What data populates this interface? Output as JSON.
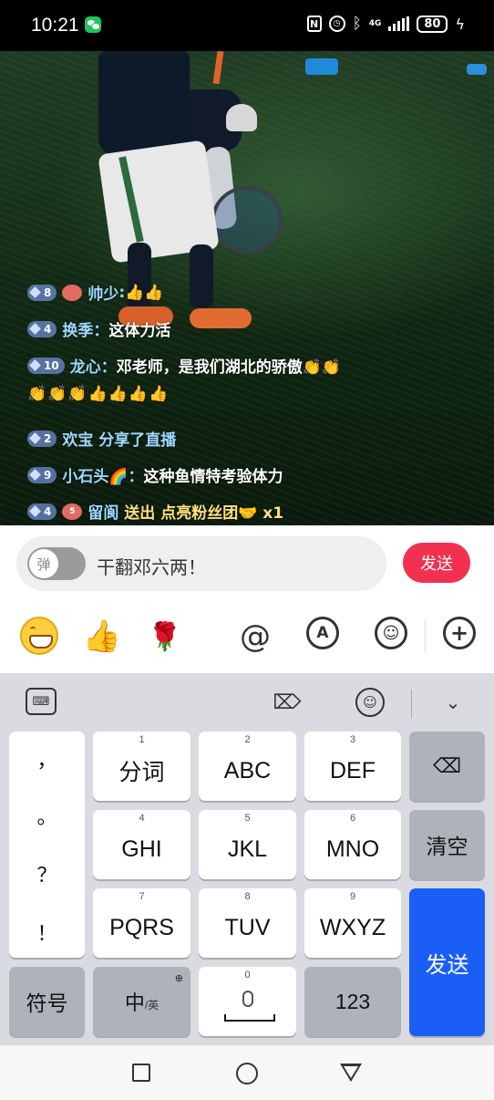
{
  "status_bar": {
    "time": "10:21",
    "network": "4G",
    "battery": "80",
    "icons": [
      "wechat-icon",
      "nfc-icon",
      "alarm-icon",
      "bluetooth-icon",
      "signal-icon",
      "battery-icon",
      "charging-icon"
    ]
  },
  "chat": {
    "lines": [
      {
        "level": "8",
        "name": "帅少",
        "sep": ":",
        "text": "👍👍"
      },
      {
        "level": "4",
        "name": "换季",
        "sep": "：",
        "text": "这体力活"
      },
      {
        "level": "10",
        "name": "龙心",
        "sep": "：",
        "text": "邓老师，是我们湖北的骄傲👏👏"
      },
      {
        "text": "👏👏👏👍👍👍👍"
      },
      {
        "level": "2",
        "name": "欢宝",
        "text": "分享了直播"
      },
      {
        "level": "9",
        "name": "小石头🌈",
        "sep": "：",
        "text": "这种鱼情特考验体力"
      },
      {
        "level": "4",
        "fan_level": "5",
        "name": "留阆",
        "text": "送出 点亮粉丝团🤝 x1"
      }
    ]
  },
  "input_bar": {
    "toggle_label": "弹",
    "input_value": "干翻邓六两！",
    "send_label": "发送"
  },
  "tool_row": {
    "icons": [
      "grinning-face-icon",
      "thumbs-up-icon",
      "rose-icon",
      "at-icon",
      "voice-icon",
      "emoji-face-icon",
      "plus-icon"
    ],
    "at_glyph": "@",
    "voice_glyph": "A",
    "plus_glyph": "+"
  },
  "keyboard": {
    "punctuation": [
      "，",
      "。",
      "？",
      "！"
    ],
    "keys": [
      {
        "num": "1",
        "label": "分词"
      },
      {
        "num": "2",
        "label": "ABC"
      },
      {
        "num": "3",
        "label": "DEF"
      },
      {
        "num": "4",
        "label": "GHI"
      },
      {
        "num": "5",
        "label": "JKL"
      },
      {
        "num": "6",
        "label": "MNO"
      },
      {
        "num": "7",
        "label": "PQRS"
      },
      {
        "num": "8",
        "label": "TUV"
      },
      {
        "num": "9",
        "label": "WXYZ"
      }
    ],
    "clear_label": "清空",
    "send_label": "发送",
    "symbol_label": "符号",
    "lang_main": "中",
    "lang_sub": "/英",
    "space_num": "0",
    "num_label": "123"
  }
}
